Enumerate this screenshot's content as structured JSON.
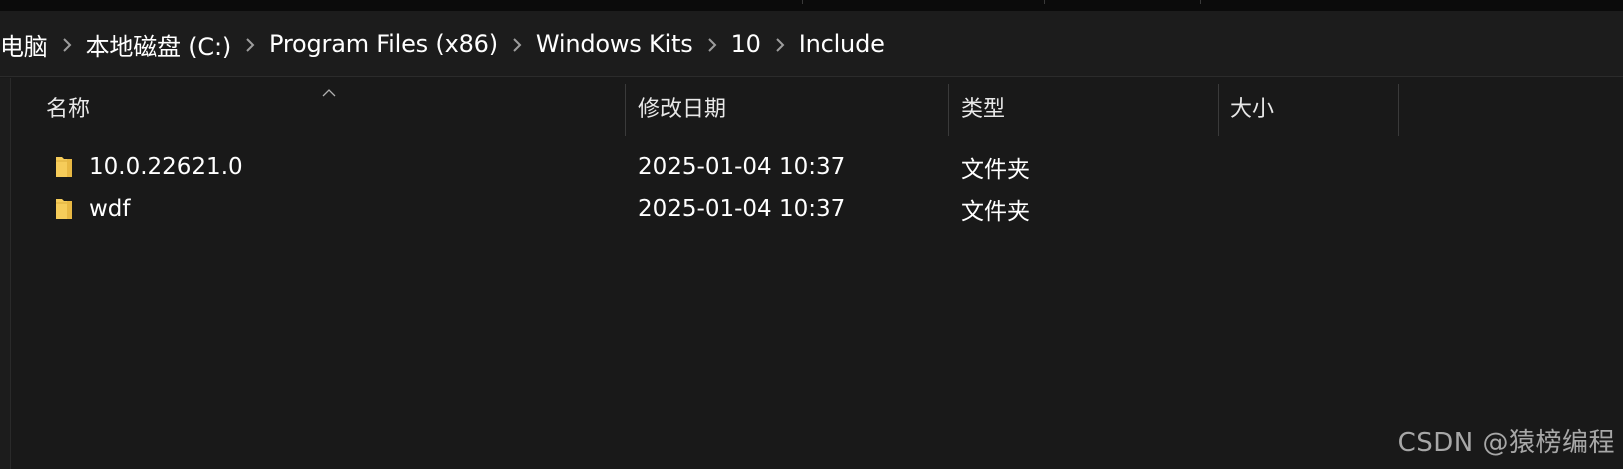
{
  "breadcrumb": {
    "items": [
      {
        "label": "电脑"
      },
      {
        "label": "本地磁盘 (C:)"
      },
      {
        "label": "Program Files (x86)"
      },
      {
        "label": "Windows Kits"
      },
      {
        "label": "10"
      },
      {
        "label": "Include"
      }
    ],
    "separator_icon": "chevron-right-icon"
  },
  "columns": {
    "name": "名称",
    "modified": "修改日期",
    "type": "类型",
    "size": "大小",
    "sorted_by": "name",
    "sort_icon": "sort-ascending-icon"
  },
  "files": [
    {
      "name": "10.0.22621.0",
      "modified": "2025-01-04 10:37",
      "type": "文件夹",
      "size": "",
      "icon": "folder-icon"
    },
    {
      "name": "wdf",
      "modified": "2025-01-04 10:37",
      "type": "文件夹",
      "size": "",
      "icon": "folder-icon"
    }
  ],
  "watermark": "CSDN @猿榜编程",
  "colors": {
    "background": "#191919",
    "folder": "#f6cc5a",
    "text": "#ffffff",
    "separator": "#9d9d9d"
  }
}
